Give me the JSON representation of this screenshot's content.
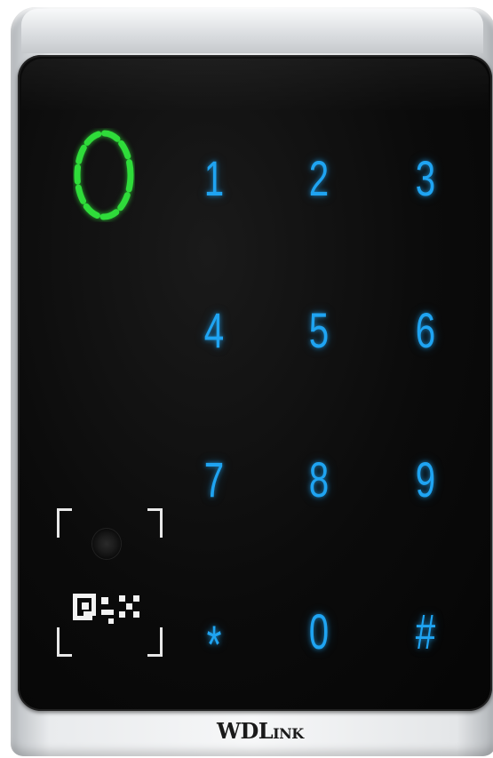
{
  "keypad": {
    "keys": [
      "1",
      "2",
      "3",
      "4",
      "5",
      "6",
      "7",
      "8",
      "9",
      "*",
      "0",
      "#"
    ]
  },
  "logo": {
    "text": "WDLink",
    "lead": "WDL",
    "rest": "INK"
  },
  "colors": {
    "key_glow": "#1fa4f2",
    "ring_indicator": "#2fdc3a",
    "panel": "#0b0b0b",
    "housing": "#e9ebed"
  },
  "icons": {
    "ring": "card-reader-ring-icon",
    "camera": "camera-lens-icon",
    "qr": "qr-code-icon"
  }
}
